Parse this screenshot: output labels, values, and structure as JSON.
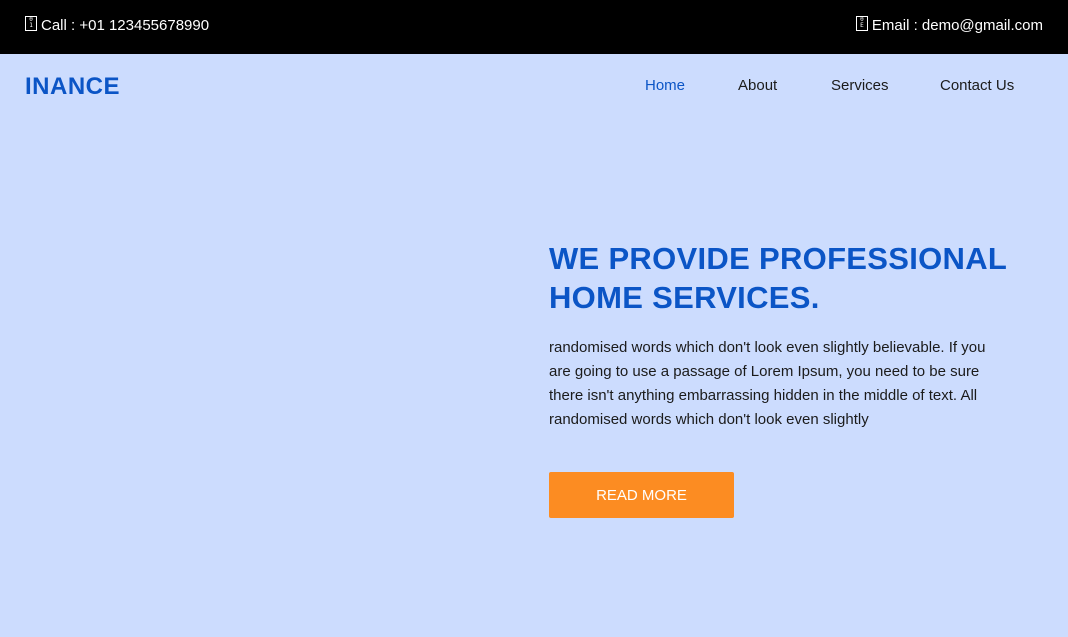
{
  "topbar": {
    "call_icon": "phone-icon",
    "call_text": "Call : +01 123455678990",
    "email_icon": "envelope-icon",
    "email_text": "Email : demo@gmail.com"
  },
  "brand": {
    "name": "INANCE"
  },
  "nav": {
    "items": [
      {
        "label": "Home",
        "active": true
      },
      {
        "label": "About",
        "active": false
      },
      {
        "label": "Services",
        "active": false
      },
      {
        "label": "Contact Us",
        "active": false
      }
    ]
  },
  "hero": {
    "title": "WE PROVIDE PROFESSIONAL HOME SERVICES.",
    "text": "randomised words which don't look even slightly believable. If you are going to use a passage of Lorem Ipsum, you need to be sure there isn't anything embarrassing hidden in the middle of text. All randomised words which don't look even slightly",
    "button_label": "READ MORE"
  },
  "colors": {
    "page_background": "#ccdcfe",
    "topbar_background": "#000000",
    "brand_blue": "#0b55c6",
    "button_orange": "#fc8c22"
  }
}
